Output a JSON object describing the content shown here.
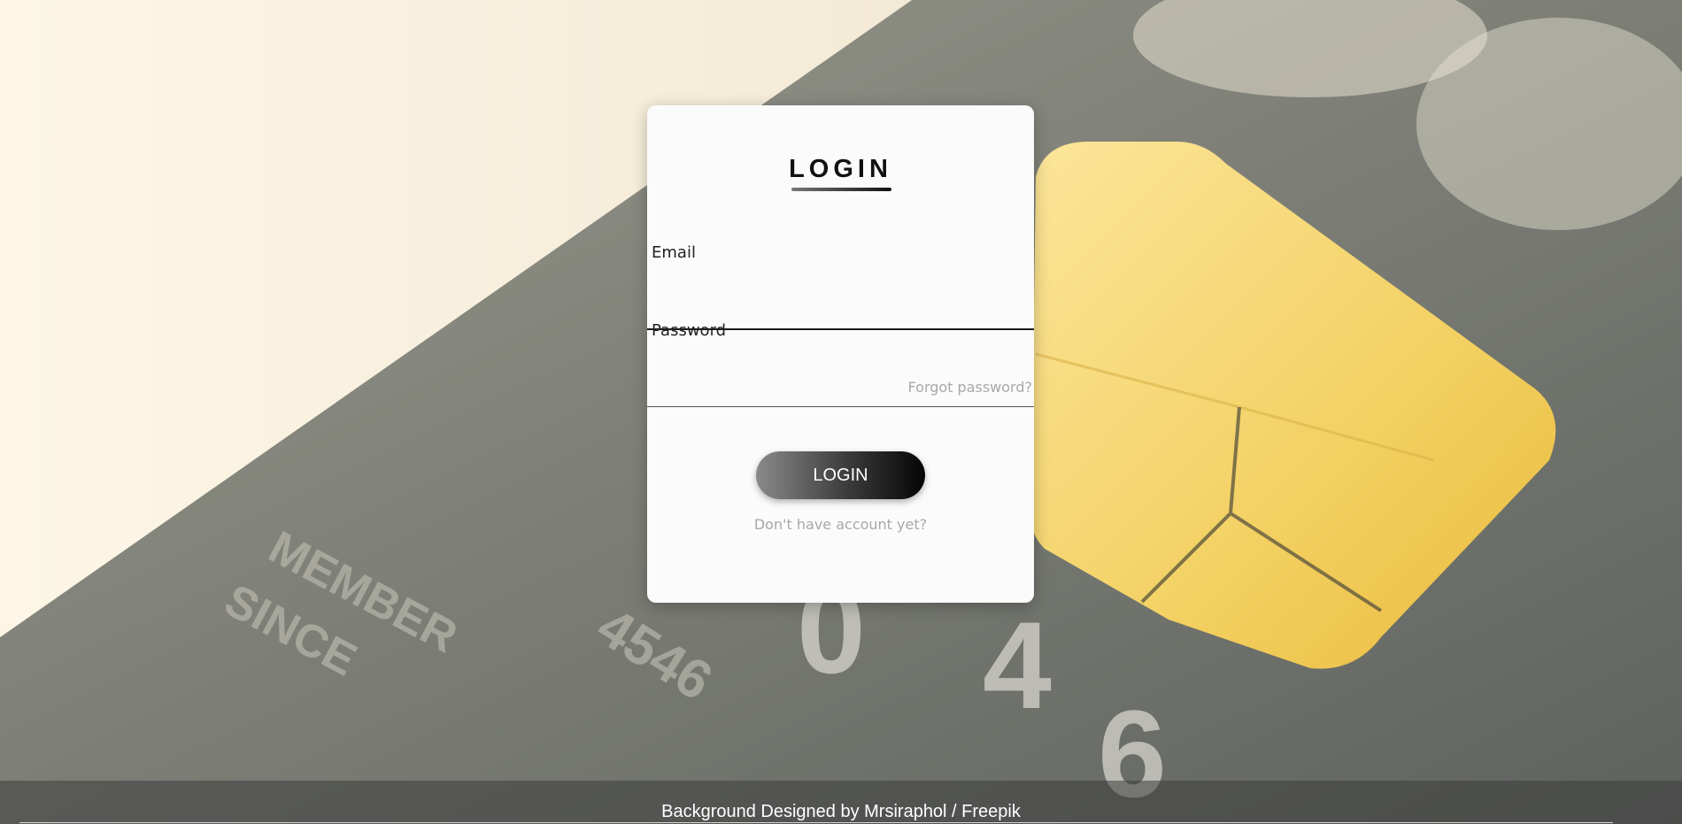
{
  "login": {
    "title": "LOGIN",
    "email_label": "Email",
    "password_label": "Password",
    "forgot_password": "Forgot password?",
    "button_label": "LOGIN",
    "signup_link": "Don't have account yet?"
  },
  "footer": {
    "credit": "Background Designed by Mrsiraphol / Freepik"
  },
  "colors": {
    "card_bg": "#fbfbfb",
    "button_dark": "#050505",
    "muted_text": "#a8a8a8",
    "chip_yellow": "#f4d46a"
  },
  "background": {
    "icon": "credit-card-chip-image"
  }
}
